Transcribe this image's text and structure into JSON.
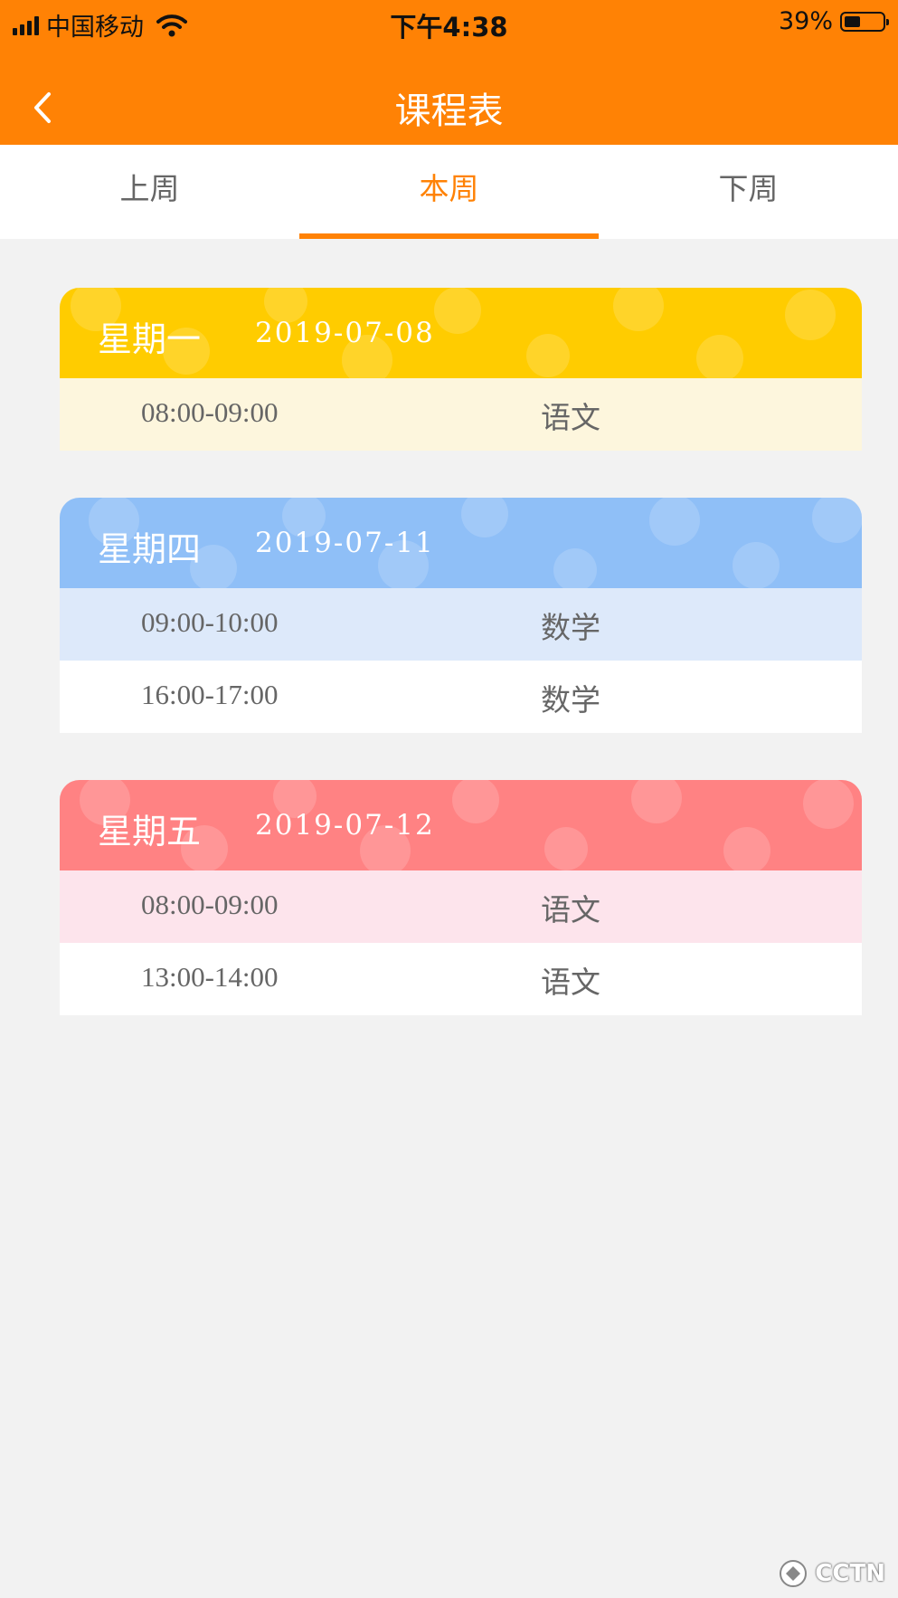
{
  "status_bar": {
    "carrier": "中国移动",
    "time": "下午4:38",
    "battery": "39%"
  },
  "header": {
    "title": "课程表"
  },
  "tabs": [
    {
      "label": "上周",
      "active": false
    },
    {
      "label": "本周",
      "active": true
    },
    {
      "label": "下周",
      "active": false
    }
  ],
  "schedule": [
    {
      "day": "星期一",
      "date": "2019-07-08",
      "header_color": "#ffcc00",
      "lessons": [
        {
          "time": "08:00-09:00",
          "subject": "语文"
        }
      ]
    },
    {
      "day": "星期四",
      "date": "2019-07-11",
      "header_color": "#8fbff7",
      "lessons": [
        {
          "time": "09:00-10:00",
          "subject": "数学"
        },
        {
          "time": "16:00-17:00",
          "subject": "数学"
        }
      ]
    },
    {
      "day": "星期五",
      "date": "2019-07-12",
      "header_color": "#ff8283",
      "lessons": [
        {
          "time": "08:00-09:00",
          "subject": "语文"
        },
        {
          "time": "13:00-14:00",
          "subject": "语文"
        }
      ]
    }
  ],
  "colors": {
    "accent": "#ff8205",
    "background": "#f2f2f2"
  },
  "watermark": "CCTN"
}
